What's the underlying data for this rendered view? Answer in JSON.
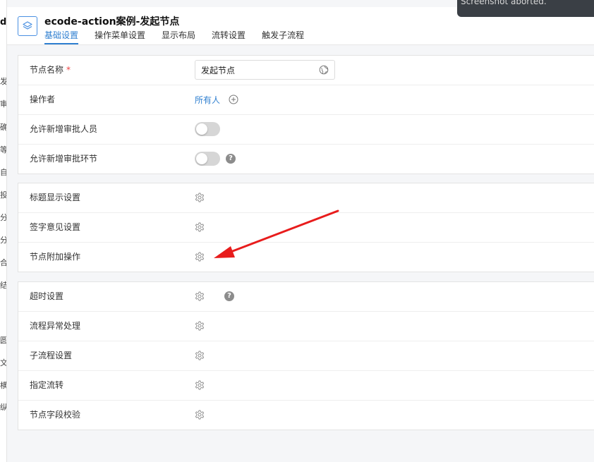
{
  "left_strip": {
    "fragments": [
      "de",
      "发",
      "审",
      "确",
      "等",
      "自",
      "投",
      "分",
      "分",
      "合",
      "结",
      "圆",
      "文",
      "横",
      "纵"
    ]
  },
  "header": {
    "title": "ecode-action案例-发起节点",
    "tabs": [
      {
        "label": "基础设置",
        "active": true
      },
      {
        "label": "操作菜单设置",
        "active": false
      },
      {
        "label": "显示布局",
        "active": false
      },
      {
        "label": "流转设置",
        "active": false
      },
      {
        "label": "触发子流程",
        "active": false
      }
    ]
  },
  "toast": {
    "text": "Screenshot aborted."
  },
  "basic": {
    "node_name": {
      "label": "节点名称",
      "required_mark": "*",
      "value": "发起节点"
    },
    "operator": {
      "label": "操作者",
      "value": "所有人"
    },
    "allow_add_approver": {
      "label": "允许新增审批人员",
      "enabled": false
    },
    "allow_add_step": {
      "label": "允许新增审批环节",
      "enabled": false
    }
  },
  "display_settings": [
    {
      "label": "标题显示设置"
    },
    {
      "label": "签字意见设置"
    },
    {
      "label": "节点附加操作"
    }
  ],
  "advanced_settings": [
    {
      "label": "超时设置"
    },
    {
      "label": "流程异常处理"
    },
    {
      "label": "子流程设置"
    },
    {
      "label": "指定流转"
    },
    {
      "label": "节点字段校验"
    }
  ],
  "colors": {
    "accent": "#2f7fd0",
    "required": "#e44444",
    "annotation_arrow": "#e81c1c"
  },
  "icons": {
    "gear": "gear-icon",
    "globe": "globe-icon",
    "plus": "plus-circle-icon",
    "help": "question-icon"
  }
}
